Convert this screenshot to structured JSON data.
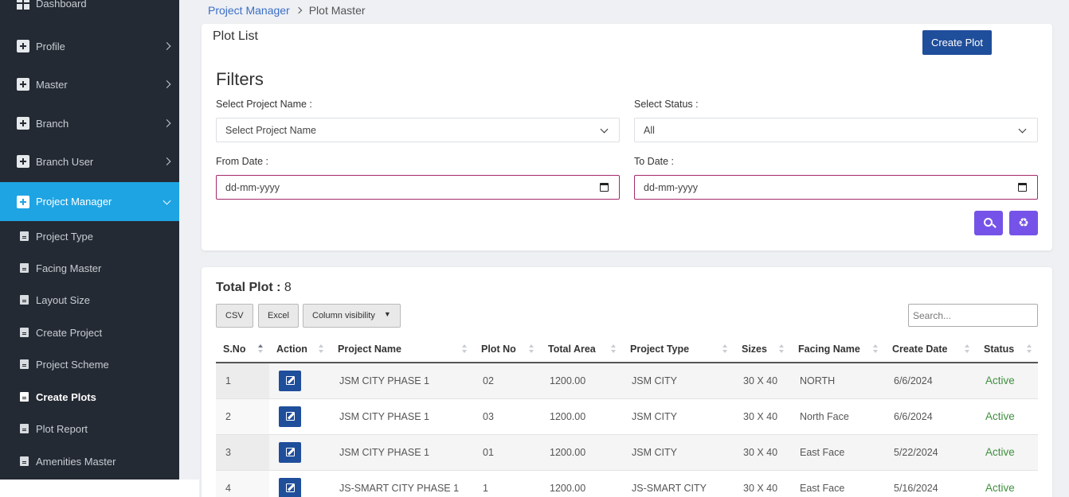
{
  "sidebar": {
    "items": [
      {
        "label": "Dashboard",
        "icon": "dashboard-icon"
      },
      {
        "label": "Profile",
        "icon": "doc-plus-icon"
      },
      {
        "label": "Master",
        "icon": "doc-plus-icon"
      },
      {
        "label": "Branch",
        "icon": "doc-plus-icon"
      },
      {
        "label": "Branch User",
        "icon": "doc-plus-icon"
      },
      {
        "label": "Project Manager",
        "icon": "doc-plus-icon",
        "active": true
      }
    ],
    "sub_items": [
      {
        "label": "Project Type"
      },
      {
        "label": "Facing Master"
      },
      {
        "label": "Layout Size"
      },
      {
        "label": "Create Project"
      },
      {
        "label": "Project Scheme"
      },
      {
        "label": "Create Plots",
        "current": true
      },
      {
        "label": "Plot Report"
      },
      {
        "label": "Amenities Master"
      }
    ]
  },
  "breadcrumb": {
    "parent": "Project Manager",
    "current": "Plot Master"
  },
  "plot_list": {
    "title": "Plot List",
    "create_button": "Create Plot"
  },
  "filters": {
    "title": "Filters",
    "project_label": "Select Project Name :",
    "project_value": "Select Project Name",
    "status_label": "Select Status :",
    "status_value": "All",
    "from_label": "From Date :",
    "from_placeholder": "dd-mm-yyyy",
    "to_label": "To Date :",
    "to_placeholder": "dd-mm-yyyy"
  },
  "listing": {
    "total_label": "Total Plot :",
    "total_value": "8",
    "buttons": {
      "csv": "CSV",
      "excel": "Excel",
      "column_visibility": "Column visibility"
    },
    "search_placeholder": "Search..."
  },
  "table": {
    "headers": [
      "S.No",
      "Action",
      "Project Name",
      "Plot No",
      "Total Area",
      "Project Type",
      "Sizes",
      "Facing Name",
      "Create Date",
      "Status"
    ],
    "rows": [
      {
        "sno": "1",
        "project_name": "JSM CITY PHASE 1",
        "plot_no": "02",
        "total_area": "1200.00",
        "project_type": "JSM CITY",
        "sizes": "30 X 40",
        "facing": "NORTH",
        "date": "6/6/2024",
        "status": "Active"
      },
      {
        "sno": "2",
        "project_name": "JSM CITY PHASE 1",
        "plot_no": "03",
        "total_area": "1200.00",
        "project_type": "JSM CITY",
        "sizes": "30 X 40",
        "facing": "North Face",
        "date": "6/6/2024",
        "status": "Active"
      },
      {
        "sno": "3",
        "project_name": "JSM CITY PHASE 1",
        "plot_no": "01",
        "total_area": "1200.00",
        "project_type": "JSM CITY",
        "sizes": "30 X 40",
        "facing": "East Face",
        "date": "5/22/2024",
        "status": "Active"
      },
      {
        "sno": "4",
        "project_name": "JS-SMART CITY PHASE 1",
        "plot_no": "1",
        "total_area": "1200.00",
        "project_type": "JS-SMART CITY",
        "sizes": "30 X 40",
        "facing": "East Face",
        "date": "5/16/2024",
        "status": "Active"
      }
    ]
  },
  "colors": {
    "sidebar_bg": "#242a33",
    "active_nav": "#1fa4e3",
    "primary": "#1f4e9b",
    "accent": "#7653e8",
    "status_active": "#3f8f3f"
  }
}
